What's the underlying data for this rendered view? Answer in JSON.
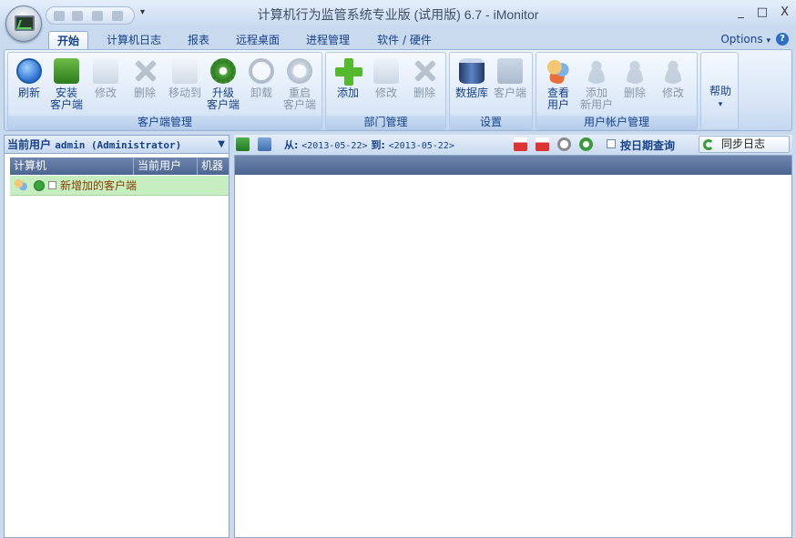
{
  "window": {
    "title": "计算机行为监管系统专业版 (试用版) 6.7 - iMonitor",
    "controls": [
      "_",
      "□",
      "X"
    ]
  },
  "qat_dropdown": "▾",
  "tabs": [
    {
      "label": "开始",
      "active": true
    },
    {
      "label": "计算机日志",
      "active": false
    },
    {
      "label": "报表",
      "active": false
    },
    {
      "label": "远程桌面",
      "active": false
    },
    {
      "label": "进程管理",
      "active": false
    },
    {
      "label": "软件 / 硬件",
      "active": false
    }
  ],
  "options_label": "Options",
  "options_arrow": "▾",
  "help_icon": "?",
  "ribbon": {
    "groups": [
      {
        "label": "客户端管理",
        "buttons": [
          {
            "label": "刷新",
            "enabled": true,
            "icon": "refresh-icon"
          },
          {
            "label": "安装\n客户端",
            "enabled": true,
            "icon": "install-client-icon"
          },
          {
            "label": "修改",
            "enabled": false,
            "icon": "edit-icon"
          },
          {
            "label": "删除",
            "enabled": false,
            "icon": "delete-icon"
          },
          {
            "label": "移动到",
            "enabled": false,
            "icon": "move-icon"
          },
          {
            "label": "升级\n客户端",
            "enabled": true,
            "icon": "upgrade-gear-icon"
          },
          {
            "label": "卸载",
            "enabled": false,
            "icon": "uninstall-icon"
          },
          {
            "label": "重启\n客户端",
            "enabled": false,
            "icon": "restart-icon"
          }
        ]
      },
      {
        "label": "部门管理",
        "buttons": [
          {
            "label": "添加",
            "enabled": true,
            "icon": "add-plus-icon"
          },
          {
            "label": "修改",
            "enabled": false,
            "icon": "edit-icon"
          },
          {
            "label": "删除",
            "enabled": false,
            "icon": "delete-icon"
          }
        ]
      },
      {
        "label": "设置",
        "buttons": [
          {
            "label": "数据库",
            "enabled": true,
            "icon": "database-icon"
          },
          {
            "label": "客户端",
            "enabled": false,
            "icon": "client-monitor-icon"
          }
        ]
      },
      {
        "label": "用户帐户管理",
        "buttons": [
          {
            "label": "查看\n用户",
            "enabled": true,
            "icon": "users-icon"
          },
          {
            "label": "添加\n新用户",
            "enabled": false,
            "icon": "add-user-icon"
          },
          {
            "label": "删除",
            "enabled": false,
            "icon": "delete-user-icon"
          },
          {
            "label": "修改",
            "enabled": false,
            "icon": "edit-user-icon"
          }
        ]
      },
      {
        "label": "",
        "buttons": [
          {
            "label": "帮助",
            "enabled": true,
            "icon": "help-dropdown-icon"
          }
        ]
      }
    ],
    "help_arrow": "▾"
  },
  "left_pane": {
    "header_prefix": "当前用户",
    "user": "admin (Administrator)",
    "header_arrow": "▼",
    "columns": [
      "计算机",
      "当前用户",
      "机器"
    ],
    "rows": [
      {
        "label": "新增加的客户端"
      }
    ]
  },
  "right_toolbar": {
    "from_label": "从:",
    "from_date": "<2013-05-22>",
    "to_label": "到:",
    "to_date": "<2013-05-22>",
    "query_by_date": "按日期查询",
    "sync_log": "同步日志"
  }
}
